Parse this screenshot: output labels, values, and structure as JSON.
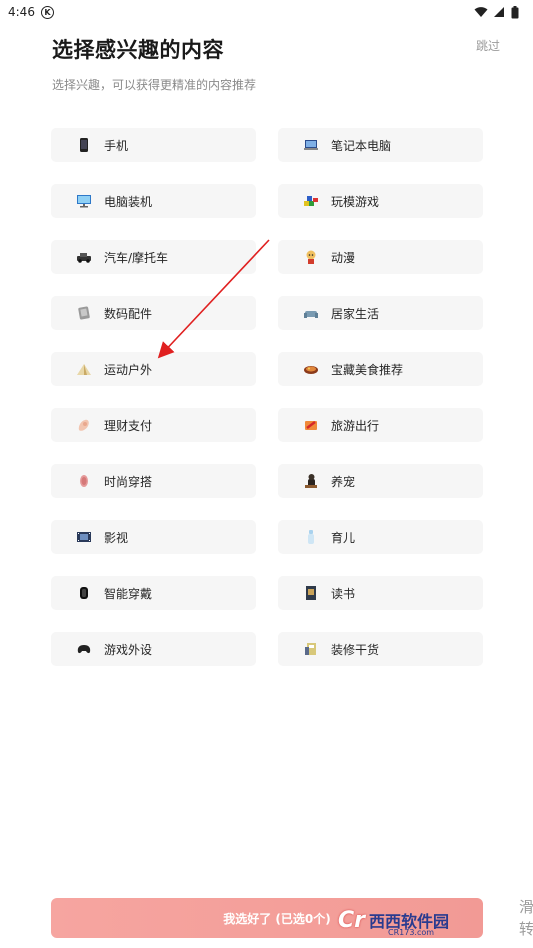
{
  "status": {
    "time": "4:46",
    "badge": "K"
  },
  "header": {
    "title": "选择感兴趣的内容",
    "subtitle": "选择兴趣，可以获得更精准的内容推荐",
    "skip_label": "跳过"
  },
  "categories": [
    {
      "label": "手机",
      "icon": "phone-icon"
    },
    {
      "label": "笔记本电脑",
      "icon": "laptop-icon"
    },
    {
      "label": "电脑装机",
      "icon": "monitor-icon"
    },
    {
      "label": "玩模游戏",
      "icon": "toy-blocks-icon"
    },
    {
      "label": "汽车/摩托车",
      "icon": "car-icon"
    },
    {
      "label": "动漫",
      "icon": "anime-character-icon"
    },
    {
      "label": "数码配件",
      "icon": "accessory-icon"
    },
    {
      "label": "居家生活",
      "icon": "sofa-icon"
    },
    {
      "label": "运动户外",
      "icon": "tent-icon"
    },
    {
      "label": "宝藏美食推荐",
      "icon": "food-icon"
    },
    {
      "label": "理财支付",
      "icon": "coins-icon"
    },
    {
      "label": "旅游出行",
      "icon": "travel-icon"
    },
    {
      "label": "时尚穿搭",
      "icon": "fashion-icon"
    },
    {
      "label": "养宠",
      "icon": "pet-icon"
    },
    {
      "label": "影视",
      "icon": "film-icon"
    },
    {
      "label": "育儿",
      "icon": "baby-bottle-icon"
    },
    {
      "label": "智能穿戴",
      "icon": "smartwatch-icon"
    },
    {
      "label": "读书",
      "icon": "book-icon"
    },
    {
      "label": "游戏外设",
      "icon": "gamepad-icon"
    },
    {
      "label": "装修干货",
      "icon": "renovation-icon"
    }
  ],
  "footer": {
    "confirm_label": "我选好了 (已选0个)",
    "watermark_brand": "西西软件园",
    "watermark_site": "CR173.com",
    "edge_text": "滑转"
  },
  "colors": {
    "chip_bg": "#f6f6f6",
    "confirm_bg": "#f29a95",
    "arrow": "#e02020"
  }
}
